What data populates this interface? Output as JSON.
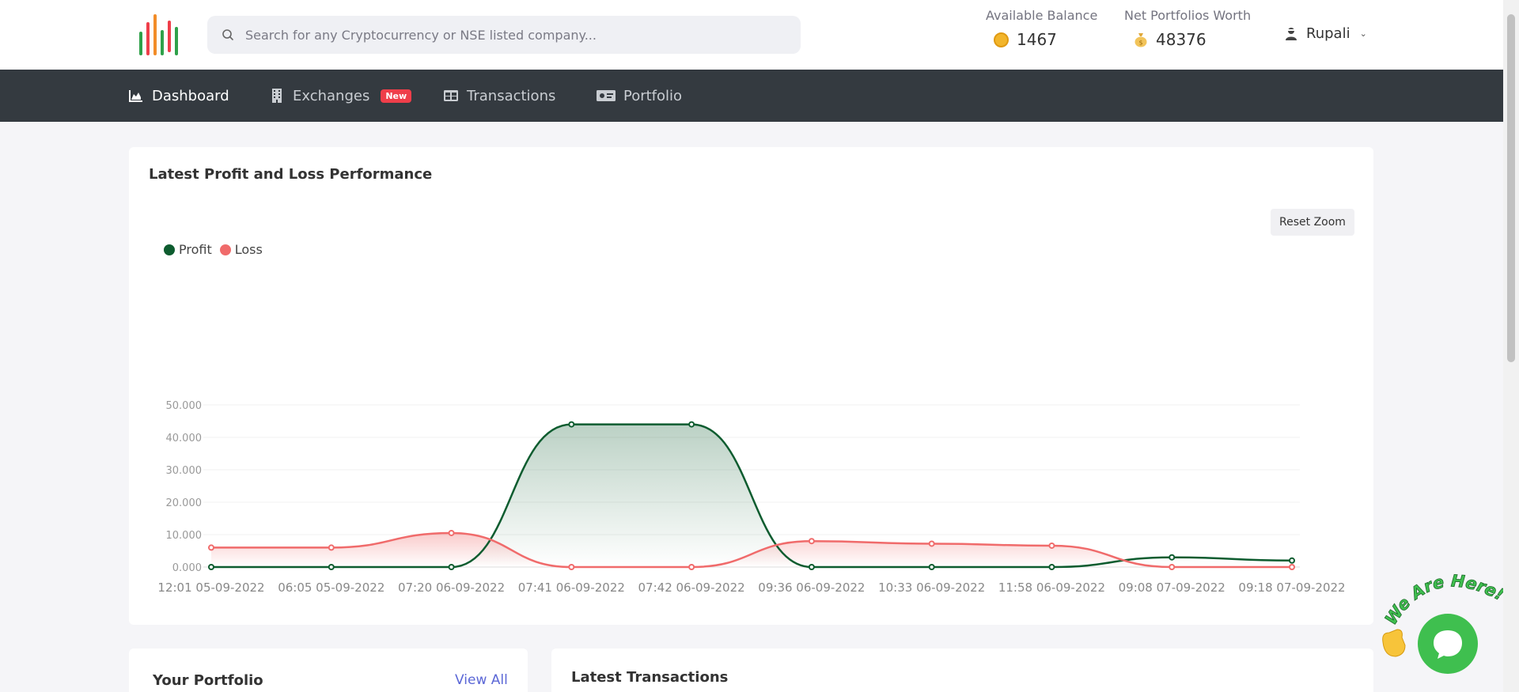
{
  "header": {
    "search_placeholder": "Search for any Cryptocurrency or NSE listed company...",
    "available_balance_label": "Available Balance",
    "available_balance_value": "1467",
    "net_worth_label": "Net Portfolios Worth",
    "net_worth_value": "48376",
    "user_name": "Rupali"
  },
  "nav": {
    "items": [
      {
        "label": "Dashboard",
        "icon": "area-chart-icon",
        "active": true
      },
      {
        "label": "Exchanges",
        "icon": "building-icon",
        "badge": "New"
      },
      {
        "label": "Transactions",
        "icon": "table-icon"
      },
      {
        "label": "Portfolio",
        "icon": "money-bill-icon"
      }
    ]
  },
  "chart_card": {
    "title": "Latest Profit and Loss Performance",
    "reset_zoom_label": "Reset Zoom"
  },
  "chart_data": {
    "type": "area",
    "title": "Latest Profit and Loss Performance",
    "categories": [
      "12:01 05-09-2022",
      "06:05 05-09-2022",
      "07:20 06-09-2022",
      "07:41 06-09-2022",
      "07:42 06-09-2022",
      "09:36 06-09-2022",
      "10:33 06-09-2022",
      "11:58 06-09-2022",
      "09:08 07-09-2022",
      "09:18 07-09-2022"
    ],
    "y_ticks": [
      "0.000",
      "10.000",
      "20.000",
      "30.000",
      "40.000",
      "50.000"
    ],
    "ylim": [
      0,
      50000
    ],
    "series": [
      {
        "name": "Profit",
        "color": "#0d5c2f",
        "values": [
          0,
          0,
          0,
          44000,
          44000,
          0,
          0,
          0,
          3000,
          2000
        ]
      },
      {
        "name": "Loss",
        "color": "#f06b6b",
        "values": [
          6000,
          6000,
          10500,
          0,
          0,
          8000,
          7200,
          6600,
          0,
          0
        ]
      }
    ],
    "legend_position": "top-left",
    "grid": true
  },
  "portfolio_card": {
    "title": "Your Portfolio",
    "view_all_label": "View All"
  },
  "transactions_card": {
    "title": "Latest Transactions"
  },
  "chat": {
    "tagline": "We Are Here!"
  },
  "colors": {
    "nav_bg": "#343a40",
    "profit": "#0d5c2f",
    "loss": "#f06b6b",
    "chat": "#3fbf4f"
  }
}
